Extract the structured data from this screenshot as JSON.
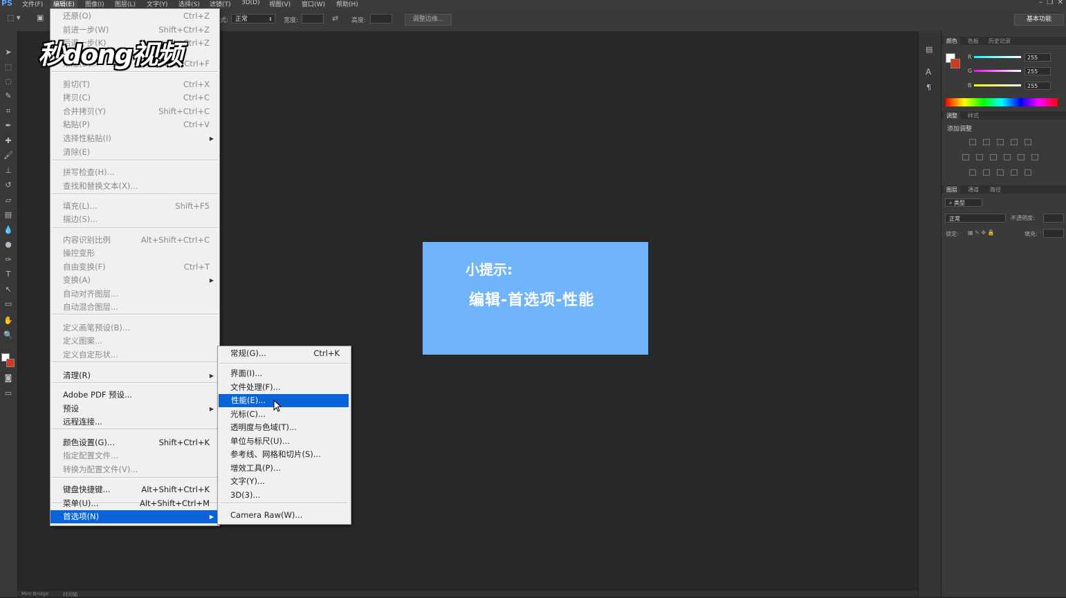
{
  "app": {
    "logo": "PS",
    "workspace": "基本功能"
  },
  "menubar": [
    "文件(F)",
    "编辑(E)",
    "图像(I)",
    "图层(L)",
    "文字(Y)",
    "选择(S)",
    "滤镜(T)",
    "3D(D)",
    "视图(V)",
    "窗口(W)",
    "帮助(H)"
  ],
  "options": {
    "style_label": "式:",
    "style_value": "正常",
    "width_label": "宽度:",
    "height_label": "高度:",
    "refine_button": "调整边缘..."
  },
  "watermark": "秒dong视频",
  "tip": {
    "line1": "小提示:",
    "line2": "编辑-首选项-性能"
  },
  "edit_menu": {
    "items": [
      {
        "label": "还原(O)",
        "shortcut": "Ctrl+Z",
        "dim": true
      },
      {
        "label": "前进一步(W)",
        "shortcut": "Shift+Ctrl+Z",
        "dim": true
      },
      {
        "label": "后退一步(K)",
        "shortcut": "Alt+Ctrl+Z",
        "dim": true
      },
      {
        "label": "渐隐(D)...",
        "shortcut": "Shift+Ctrl+F",
        "dim": true
      },
      {
        "label": "剪切(T)",
        "shortcut": "Ctrl+X",
        "dim": true
      },
      {
        "label": "拷贝(C)",
        "shortcut": "Ctrl+C",
        "dim": true
      },
      {
        "label": "合并拷贝(Y)",
        "shortcut": "Shift+Ctrl+C",
        "dim": true
      },
      {
        "label": "粘贴(P)",
        "shortcut": "Ctrl+V",
        "dim": true
      },
      {
        "label": "选择性粘贴(I)",
        "shortcut": "",
        "dim": true,
        "submenu": true
      },
      {
        "label": "清除(E)",
        "shortcut": "",
        "dim": true
      },
      {
        "label": "拼写检查(H)...",
        "shortcut": "",
        "dim": true
      },
      {
        "label": "查找和替换文本(X)...",
        "shortcut": "",
        "dim": true
      },
      {
        "label": "填充(L)...",
        "shortcut": "Shift+F5",
        "dim": true
      },
      {
        "label": "描边(S)...",
        "shortcut": "",
        "dim": true
      },
      {
        "label": "内容识别比例",
        "shortcut": "Alt+Shift+Ctrl+C",
        "dim": true
      },
      {
        "label": "操控变形",
        "shortcut": "",
        "dim": true
      },
      {
        "label": "自由变换(F)",
        "shortcut": "Ctrl+T",
        "dim": true
      },
      {
        "label": "变换(A)",
        "shortcut": "",
        "dim": true,
        "submenu": true
      },
      {
        "label": "自动对齐图层...",
        "shortcut": "",
        "dim": true
      },
      {
        "label": "自动混合图层...",
        "shortcut": "",
        "dim": true
      },
      {
        "label": "定义画笔预设(B)...",
        "shortcut": "",
        "dim": true
      },
      {
        "label": "定义图案...",
        "shortcut": "",
        "dim": true
      },
      {
        "label": "定义自定形状...",
        "shortcut": "",
        "dim": true
      },
      {
        "label": "清理(R)",
        "shortcut": "",
        "dim": false,
        "submenu": true
      },
      {
        "label": "Adobe PDF 预设...",
        "shortcut": "",
        "dim": false
      },
      {
        "label": "预设",
        "shortcut": "",
        "dim": false,
        "submenu": true
      },
      {
        "label": "远程连接...",
        "shortcut": "",
        "dim": false
      },
      {
        "label": "颜色设置(G)...",
        "shortcut": "Shift+Ctrl+K",
        "dim": false
      },
      {
        "label": "指定配置文件...",
        "shortcut": "",
        "dim": true
      },
      {
        "label": "转换为配置文件(V)...",
        "shortcut": "",
        "dim": true
      },
      {
        "label": "键盘快捷键...",
        "shortcut": "Alt+Shift+Ctrl+K",
        "dim": false
      },
      {
        "label": "菜单(U)...",
        "shortcut": "Alt+Shift+Ctrl+M",
        "dim": false
      },
      {
        "label": "首选项(N)",
        "shortcut": "",
        "dim": false,
        "submenu": true,
        "selected": true
      }
    ]
  },
  "prefs_menu": {
    "items": [
      {
        "label": "常规(G)...",
        "shortcut": "Ctrl+K"
      },
      {
        "label": "界面(I)...",
        "shortcut": ""
      },
      {
        "label": "文件处理(F)...",
        "shortcut": ""
      },
      {
        "label": "性能(E)...",
        "shortcut": "",
        "selected": true
      },
      {
        "label": "光标(C)...",
        "shortcut": ""
      },
      {
        "label": "透明度与色域(T)...",
        "shortcut": ""
      },
      {
        "label": "单位与标尺(U)...",
        "shortcut": ""
      },
      {
        "label": "参考线、网格和切片(S)...",
        "shortcut": ""
      },
      {
        "label": "增效工具(P)...",
        "shortcut": ""
      },
      {
        "label": "文字(Y)...",
        "shortcut": ""
      },
      {
        "label": "3D(3)...",
        "shortcut": ""
      },
      {
        "label": "Camera Raw(W)...",
        "shortcut": ""
      }
    ]
  },
  "panels": {
    "color_tabs": [
      "颜色",
      "色板",
      "历史记录"
    ],
    "channels": [
      {
        "name": "R",
        "value": "255",
        "color": "#ff3030"
      },
      {
        "name": "G",
        "value": "255",
        "color": "#30ff30"
      },
      {
        "name": "B",
        "value": "255",
        "color": "#3090ff"
      }
    ],
    "adjust_tabs": [
      "调整",
      "样式"
    ],
    "adjust_title": "添加调整",
    "layers_tabs": [
      "图层",
      "通道",
      "路径"
    ],
    "layer_filter": "类型",
    "blend_mode": "正常",
    "opacity_label": "不透明度:",
    "lock_label": "锁定:",
    "fill_label": "填充:"
  },
  "status_tabs": [
    "Mini Bridge",
    "时间轴"
  ],
  "colors": {
    "accent": "#0a64d8",
    "tip_bg": "#70b5fb"
  }
}
